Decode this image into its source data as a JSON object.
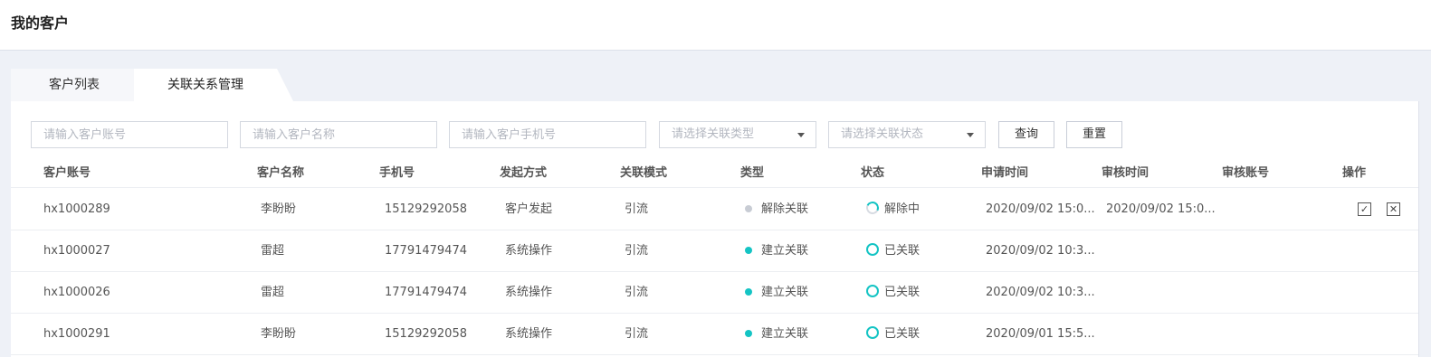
{
  "page": {
    "title": "我的客户"
  },
  "tabs": [
    {
      "label": "客户列表",
      "active": false
    },
    {
      "label": "关联关系管理",
      "active": true
    }
  ],
  "filters": {
    "account_placeholder": "请输入客户账号",
    "name_placeholder": "请输入客户名称",
    "phone_placeholder": "请输入客户手机号",
    "type_placeholder": "请选择关联类型",
    "status_placeholder": "请选择关联状态",
    "query_label": "查询",
    "reset_label": "重置"
  },
  "table": {
    "columns": [
      "客户账号",
      "客户名称",
      "手机号",
      "发起方式",
      "关联模式",
      "类型",
      "状态",
      "申请时间",
      "审核时间",
      "审核账号",
      "操作"
    ],
    "rows": [
      {
        "account": "hx1000289",
        "name": "李盼盼",
        "phone": "15129292058",
        "initiation": "客户发起",
        "mode": "引流",
        "type": "解除关联",
        "type_color": "#c8ccd4",
        "status": "解除中",
        "status_kind": "pending",
        "apply_time": "2020/09/02 15:0...",
        "review_time": "2020/09/02 15:0...",
        "reviewer": "",
        "actions": [
          "approve-icon",
          "reject-icon"
        ]
      },
      {
        "account": "hx1000027",
        "name": "雷超",
        "phone": "17791479474",
        "initiation": "系统操作",
        "mode": "引流",
        "type": "建立关联",
        "type_color": "#14c4c4",
        "status": "已关联",
        "status_kind": "done",
        "apply_time": "2020/09/02 10:3...",
        "review_time": "",
        "reviewer": "",
        "actions": []
      },
      {
        "account": "hx1000026",
        "name": "雷超",
        "phone": "17791479474",
        "initiation": "系统操作",
        "mode": "引流",
        "type": "建立关联",
        "type_color": "#14c4c4",
        "status": "已关联",
        "status_kind": "done",
        "apply_time": "2020/09/02 10:3...",
        "review_time": "",
        "reviewer": "",
        "actions": []
      },
      {
        "account": "hx1000291",
        "name": "李盼盼",
        "phone": "15129292058",
        "initiation": "系统操作",
        "mode": "引流",
        "type": "建立关联",
        "type_color": "#14c4c4",
        "status": "已关联",
        "status_kind": "done",
        "apply_time": "2020/09/01 15:5...",
        "review_time": "",
        "reviewer": "",
        "actions": []
      }
    ]
  }
}
